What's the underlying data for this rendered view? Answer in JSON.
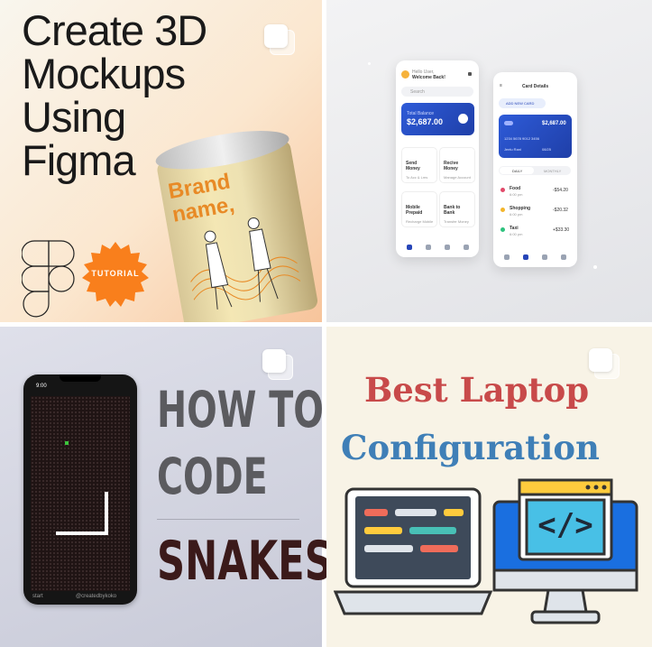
{
  "tile1": {
    "title": "Create 3D\nMockups\nUsing\nFigma",
    "badge": "TUTORIAL",
    "can_text": "Brand\nname,"
  },
  "tile2": {
    "phone_left": {
      "greeting": "Hello User,",
      "welcome": "Welcome Back!",
      "search": "Search",
      "balance_label": "Total Balance",
      "balance": "$2,687.00",
      "actions": [
        {
          "label": "Send\nMoney",
          "sub": "To Acc & Lms"
        },
        {
          "label": "Recive\nMoney",
          "sub": "Manage Account"
        },
        {
          "label": "Mobile\nPrepaid",
          "sub": "Recharge Mobile"
        },
        {
          "label": "Bank to\nBank",
          "sub": "Transfer Money"
        }
      ]
    },
    "phone_right": {
      "title": "Card Details",
      "add_card": "ADD NEW CARD",
      "card_amount": "$2,687.00",
      "card_number": "1234 5678 9012 3456",
      "card_holder": "Jeelu Rani",
      "card_expiry": "08/25",
      "toggle_daily": "DAILY",
      "toggle_monthly": "MONTHLY",
      "transactions": [
        {
          "name": "Food",
          "time": "6:00 pm",
          "amount": "-$54.20"
        },
        {
          "name": "Shopping",
          "time": "6:00 pm",
          "amount": "-$20.32"
        },
        {
          "name": "Taxi",
          "time": "6:00 pm",
          "amount": "+$33.30"
        }
      ]
    }
  },
  "tile3": {
    "phone_time": "9:00",
    "footer_left": "start",
    "footer_right": "@createdbykoko",
    "line1": "HOW TO",
    "line2": "CODE",
    "line3": "SNAKES"
  },
  "tile4": {
    "line1": "Best Laptop",
    "line2": "Configuration",
    "code_symbol": "</>"
  },
  "colors": {
    "badge_orange": "#f97f1c",
    "snake_text_gray": "#5b5b5f",
    "snake_text_dark": "#3b1a1a",
    "t4_red": "#c84a4a",
    "t4_blue": "#3f7fb7",
    "monitor_blue": "#1a6fe0",
    "card_blue": "#2645b8"
  }
}
